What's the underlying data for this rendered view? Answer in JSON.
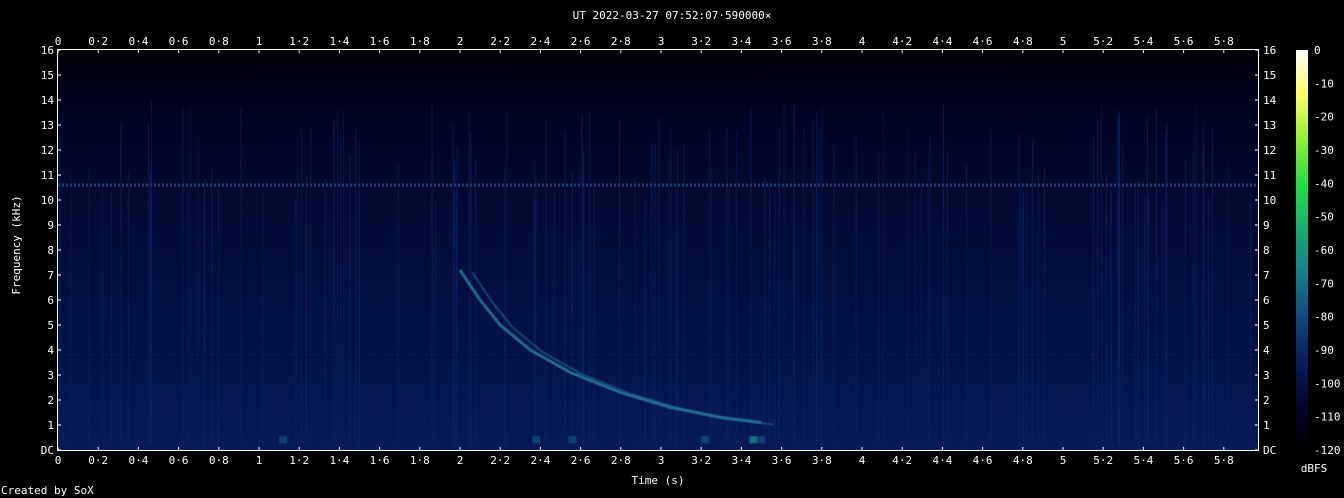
{
  "chart_data": {
    "type": "heatmap",
    "title": "UT 2022-03-27 07:52:07·590000×",
    "xlabel": "Time (s)",
    "ylabel": "Frequency (kHz)",
    "xlim": [
      0,
      5.975
    ],
    "ylim": [
      0,
      16
    ],
    "grid": false,
    "x_ticks": [
      "0",
      "0·2",
      "0·4",
      "0·6",
      "0·8",
      "1",
      "1·2",
      "1·4",
      "1·6",
      "1·8",
      "2",
      "2·2",
      "2·4",
      "2·6",
      "2·8",
      "3",
      "3·2",
      "3·4",
      "3·6",
      "3·8",
      "4",
      "4·2",
      "4·4",
      "4·6",
      "4·8",
      "5",
      "5·2",
      "5·4",
      "5·6",
      "5·8"
    ],
    "y_ticks": [
      "DC",
      "1",
      "2",
      "3",
      "4",
      "5",
      "6",
      "7",
      "8",
      "9",
      "10",
      "11",
      "12",
      "13",
      "14",
      "15",
      "16"
    ],
    "colorbar": {
      "label": "dBFS",
      "range": [
        -120,
        0
      ],
      "ticks": [
        "0",
        "-10",
        "-20",
        "-30",
        "-40",
        "-50",
        "-60",
        "-70",
        "-80",
        "-90",
        "-100",
        "-110",
        "-120"
      ],
      "stops": [
        "#000000",
        "#05052a",
        "#0a1e5c",
        "#0f4a80",
        "#12808a",
        "#16b070",
        "#20e040",
        "#90f030",
        "#ffff60",
        "#ffffff"
      ]
    },
    "background_colors": {
      "quiet": "#000008",
      "noise": "#061850",
      "line": "#2a8aa8",
      "bright": "#38d0b0"
    },
    "tones": [
      {
        "freq_khz": 10.6,
        "level_dbfs": -85
      },
      {
        "freq_khz": 0.5,
        "level_dbfs": -95
      },
      {
        "freq_khz": 1.2,
        "level_dbfs": -98
      },
      {
        "freq_khz": 2.6,
        "level_dbfs": -100
      },
      {
        "freq_khz": 3.7,
        "level_dbfs": -102
      }
    ],
    "sferics": [
      {
        "t": 0.76,
        "f_top": 14.5,
        "f_bottom": 5.3,
        "level_dbfs": -82
      },
      {
        "t": 1.12,
        "f_top": 14.2,
        "f_bottom": 4.3,
        "level_dbfs": -78
      },
      {
        "t": 1.22,
        "f_top": 13.8,
        "f_bottom": 4.6,
        "level_dbfs": -80
      },
      {
        "t": 1.3,
        "f_top": 13.5,
        "f_bottom": 4.6,
        "level_dbfs": -80
      },
      {
        "t": 1.52,
        "f_top": 13.0,
        "f_bottom": 5.5,
        "level_dbfs": -88
      },
      {
        "t": 2.0,
        "f_top": 14.2,
        "f_bottom": 4.6,
        "level_dbfs": -80
      },
      {
        "t": 2.38,
        "f_top": 14.8,
        "f_bottom": 0.3,
        "level_dbfs": -78
      },
      {
        "t": 2.42,
        "f_top": 14.2,
        "f_bottom": 0.3,
        "level_dbfs": -80
      },
      {
        "t": 2.56,
        "f_top": 14.0,
        "f_bottom": 0.3,
        "level_dbfs": -80
      },
      {
        "t": 3.02,
        "f_top": 14.6,
        "f_bottom": 0.3,
        "level_dbfs": -82
      },
      {
        "t": 3.08,
        "f_top": 14.0,
        "f_bottom": 0.3,
        "level_dbfs": -84
      },
      {
        "t": 3.44,
        "f_top": 14.2,
        "f_bottom": 0.3,
        "level_dbfs": -76
      },
      {
        "t": 3.48,
        "f_top": 13.5,
        "f_bottom": 1.5,
        "level_dbfs": -80
      },
      {
        "t": 3.88,
        "f_top": 12.0,
        "f_bottom": 4.4,
        "level_dbfs": -84
      },
      {
        "t": 3.94,
        "f_top": 12.0,
        "f_bottom": 4.4,
        "level_dbfs": -84
      }
    ],
    "whistler": [
      {
        "t": 2.0,
        "f_khz": 7.2
      },
      {
        "t": 2.1,
        "f_khz": 6.0
      },
      {
        "t": 2.2,
        "f_khz": 5.0
      },
      {
        "t": 2.35,
        "f_khz": 4.0
      },
      {
        "t": 2.55,
        "f_khz": 3.1
      },
      {
        "t": 2.8,
        "f_khz": 2.3
      },
      {
        "t": 3.05,
        "f_khz": 1.7
      },
      {
        "t": 3.3,
        "f_khz": 1.3
      },
      {
        "t": 3.5,
        "f_khz": 1.1
      }
    ],
    "low_bursts": [
      {
        "t": 0.64,
        "level_dbfs": -90
      },
      {
        "t": 1.12,
        "level_dbfs": -80
      },
      {
        "t": 2.38,
        "level_dbfs": -80
      },
      {
        "t": 2.56,
        "level_dbfs": -82
      },
      {
        "t": 3.22,
        "level_dbfs": -84
      },
      {
        "t": 3.46,
        "level_dbfs": -70
      },
      {
        "t": 3.5,
        "level_dbfs": -74
      }
    ]
  },
  "footer": {
    "credit": "Created by SoX"
  }
}
